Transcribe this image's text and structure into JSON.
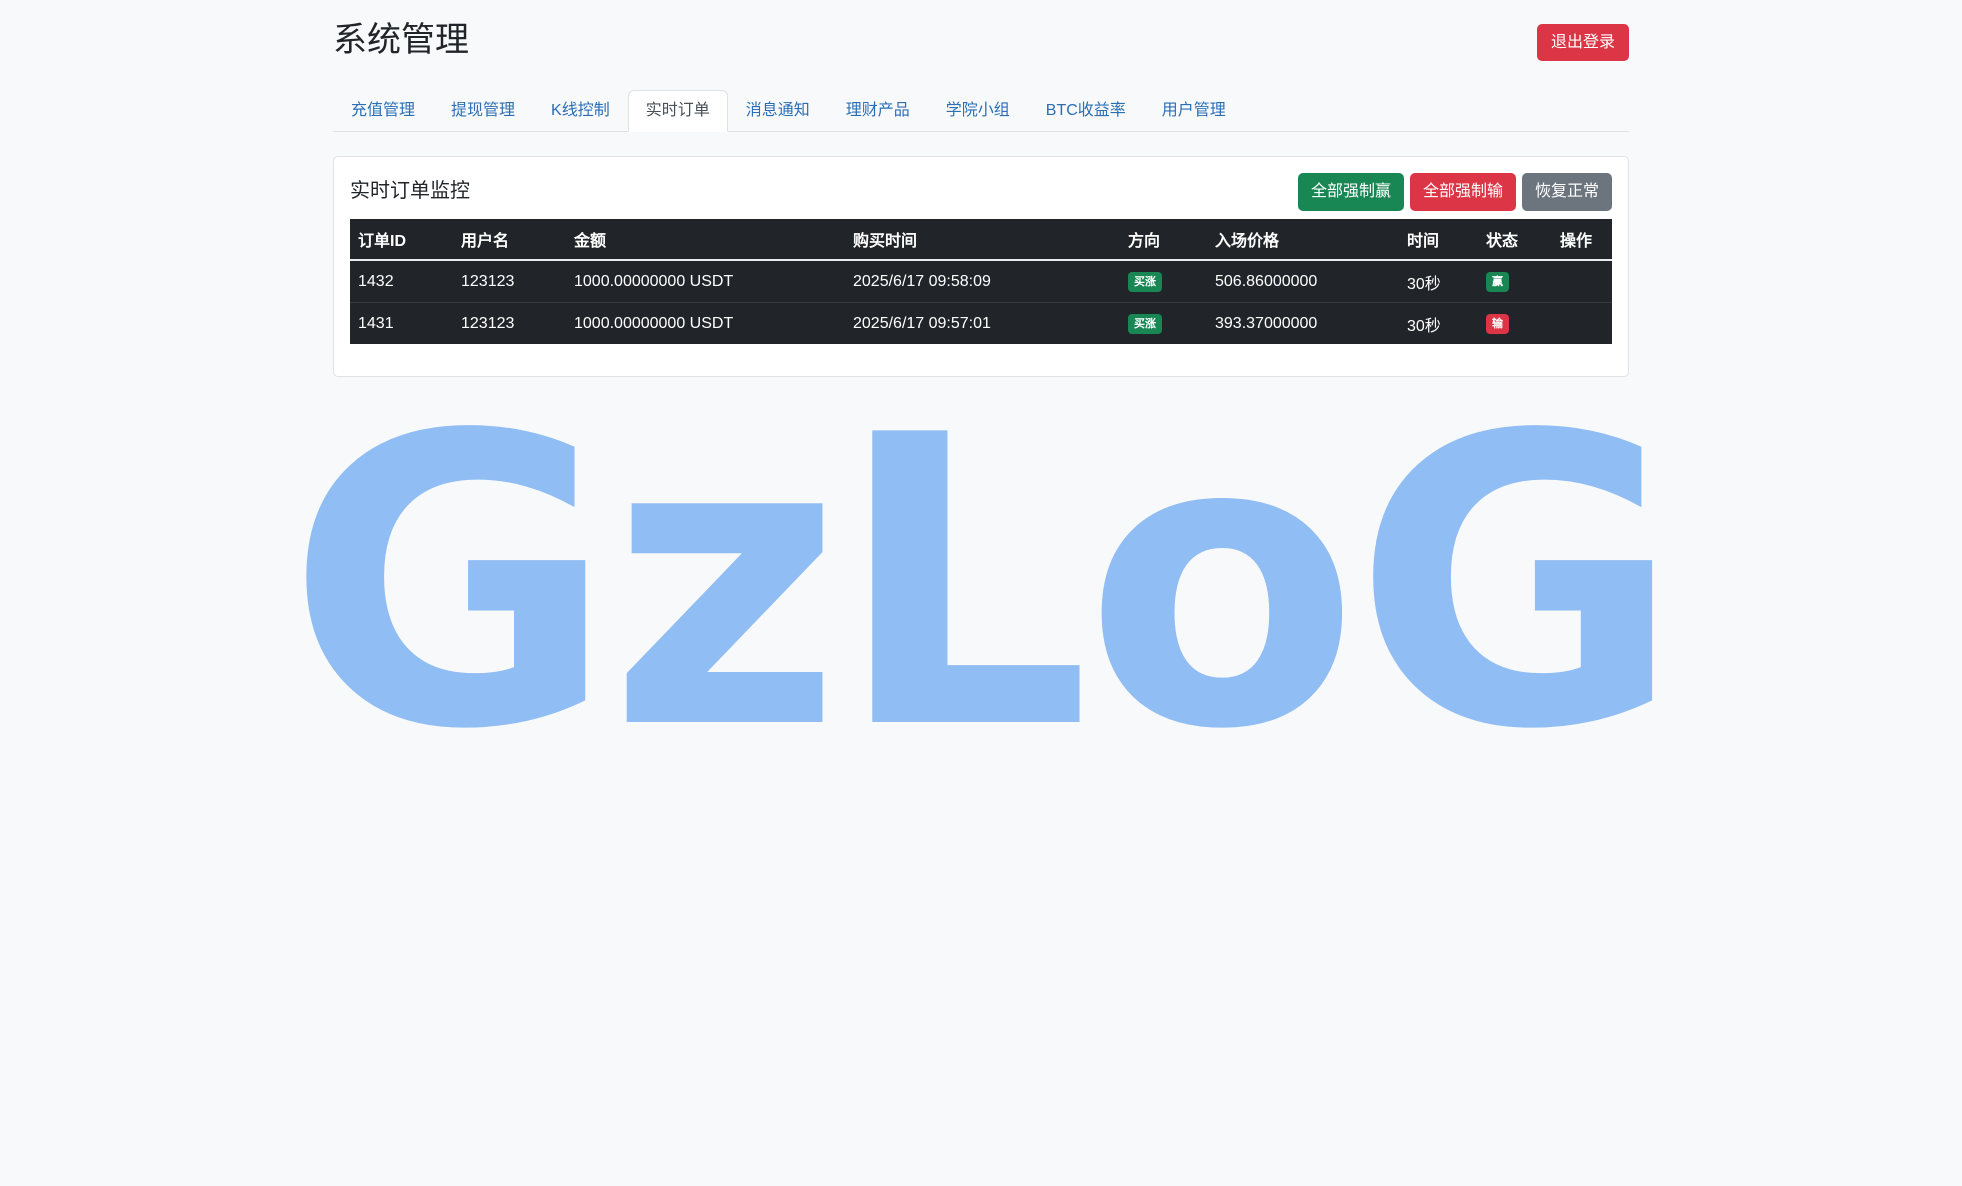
{
  "header": {
    "title": "系统管理",
    "logout_label": "退出登录"
  },
  "tabs": [
    {
      "label": "充值管理",
      "active": false
    },
    {
      "label": "提现管理",
      "active": false
    },
    {
      "label": "K线控制",
      "active": false
    },
    {
      "label": "实时订单",
      "active": true
    },
    {
      "label": "消息通知",
      "active": false
    },
    {
      "label": "理财产品",
      "active": false
    },
    {
      "label": "学院小组",
      "active": false
    },
    {
      "label": "BTC收益率",
      "active": false
    },
    {
      "label": "用户管理",
      "active": false
    }
  ],
  "panel": {
    "title": "实时订单监控",
    "force_win_label": "全部强制赢",
    "force_lose_label": "全部强制输",
    "restore_label": "恢复正常"
  },
  "table": {
    "columns": [
      "订单ID",
      "用户名",
      "金额",
      "购买时间",
      "方向",
      "入场价格",
      "时间",
      "状态",
      "操作"
    ],
    "rows": [
      {
        "id": "1432",
        "username": "123123",
        "amount": "1000.00000000 USDT",
        "time": "2025/6/17 09:58:09",
        "direction": "买涨",
        "entry_price": "506.86000000",
        "duration": "30秒",
        "status": "赢",
        "status_color": "#198754"
      },
      {
        "id": "1431",
        "username": "123123",
        "amount": "1000.00000000 USDT",
        "time": "2025/6/17 09:57:01",
        "direction": "买涨",
        "entry_price": "393.37000000",
        "duration": "30秒",
        "status": "输",
        "status_color": "#dc3545"
      }
    ]
  },
  "watermark": {
    "text": "GzLoG",
    "color": "#90bdf3"
  },
  "colors": {
    "danger": "#dc3545",
    "success": "#198754",
    "secondary": "#6c757d",
    "link": "#2a6fb5"
  }
}
